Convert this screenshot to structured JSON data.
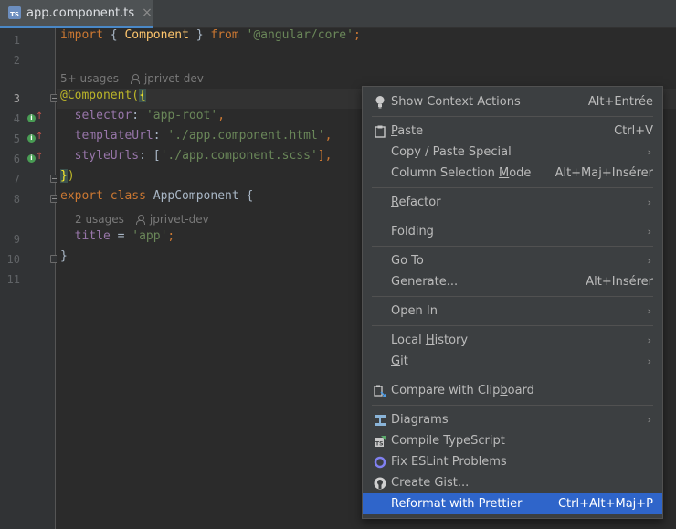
{
  "tab": {
    "title": "app.component.ts",
    "icon_text": "TS",
    "close": "×"
  },
  "gutter": {
    "line_numbers": [
      "1",
      "2",
      "3",
      "4",
      "5",
      "6",
      "7",
      "8",
      "9",
      "10",
      "11"
    ]
  },
  "code": {
    "line1": {
      "kw": "import",
      "open": " { ",
      "name": "Component",
      "close": " } ",
      "from": "from",
      "str": "'@angular/core'",
      "semi": ";"
    },
    "hint1": {
      "usages": "5+ usages",
      "author": "jprivet-dev"
    },
    "line3": {
      "at": "@Component(",
      "brace": "{"
    },
    "line4": {
      "prop": "selector",
      "colon": ": ",
      "str": "'app-root'",
      "comma": ","
    },
    "line5": {
      "prop": "templateUrl",
      "colon": ": ",
      "str": "'./app.component.html'",
      "comma": ","
    },
    "line6": {
      "prop": "styleUrls",
      "colon": ": [",
      "str": "'./app.component.scss'",
      "comma": "],"
    },
    "line7": {
      "brace": "}",
      "paren": ")"
    },
    "line8": {
      "kw": "export class",
      "name": " AppComponent",
      "brace": " {"
    },
    "hint2": {
      "usages": "2 usages",
      "author": "jprivet-dev"
    },
    "line9": {
      "prop": "title",
      "eq": " = ",
      "str": "'app'",
      "semi": ";"
    },
    "line10": {
      "brace": "}"
    }
  },
  "menu": {
    "show_context_actions": {
      "label": "Show Context Actions",
      "shortcut": "Alt+Entrée"
    },
    "paste": {
      "label": "Paste",
      "shortcut": "Ctrl+V"
    },
    "copy_paste_special": {
      "label": "Copy / Paste Special"
    },
    "column_selection_mode": {
      "label": "Column Selection Mode",
      "shortcut": "Alt+Maj+Insérer"
    },
    "refactor": {
      "label": "Refactor"
    },
    "folding": {
      "label": "Folding"
    },
    "go_to": {
      "label": "Go To"
    },
    "generate": {
      "label": "Generate...",
      "shortcut": "Alt+Insérer"
    },
    "open_in": {
      "label": "Open In"
    },
    "local_history": {
      "label": "Local History"
    },
    "git": {
      "label": "Git"
    },
    "compare_clipboard": {
      "label": "Compare with Clipboard"
    },
    "diagrams": {
      "label": "Diagrams"
    },
    "compile_typescript": {
      "label": "Compile TypeScript"
    },
    "fix_eslint": {
      "label": "Fix ESLint Problems"
    },
    "create_gist": {
      "label": "Create Gist..."
    },
    "reformat_prettier": {
      "label": "Reformat with Prettier",
      "shortcut": "Ctrl+Alt+Maj+P"
    },
    "submenu_arrow": "›"
  },
  "colors": {
    "background": "#2b2b2b",
    "menu_background": "#3c3f41",
    "selection": "#2f65ca",
    "keyword": "#cc7832",
    "string": "#6a8759",
    "property": "#9876aa"
  }
}
